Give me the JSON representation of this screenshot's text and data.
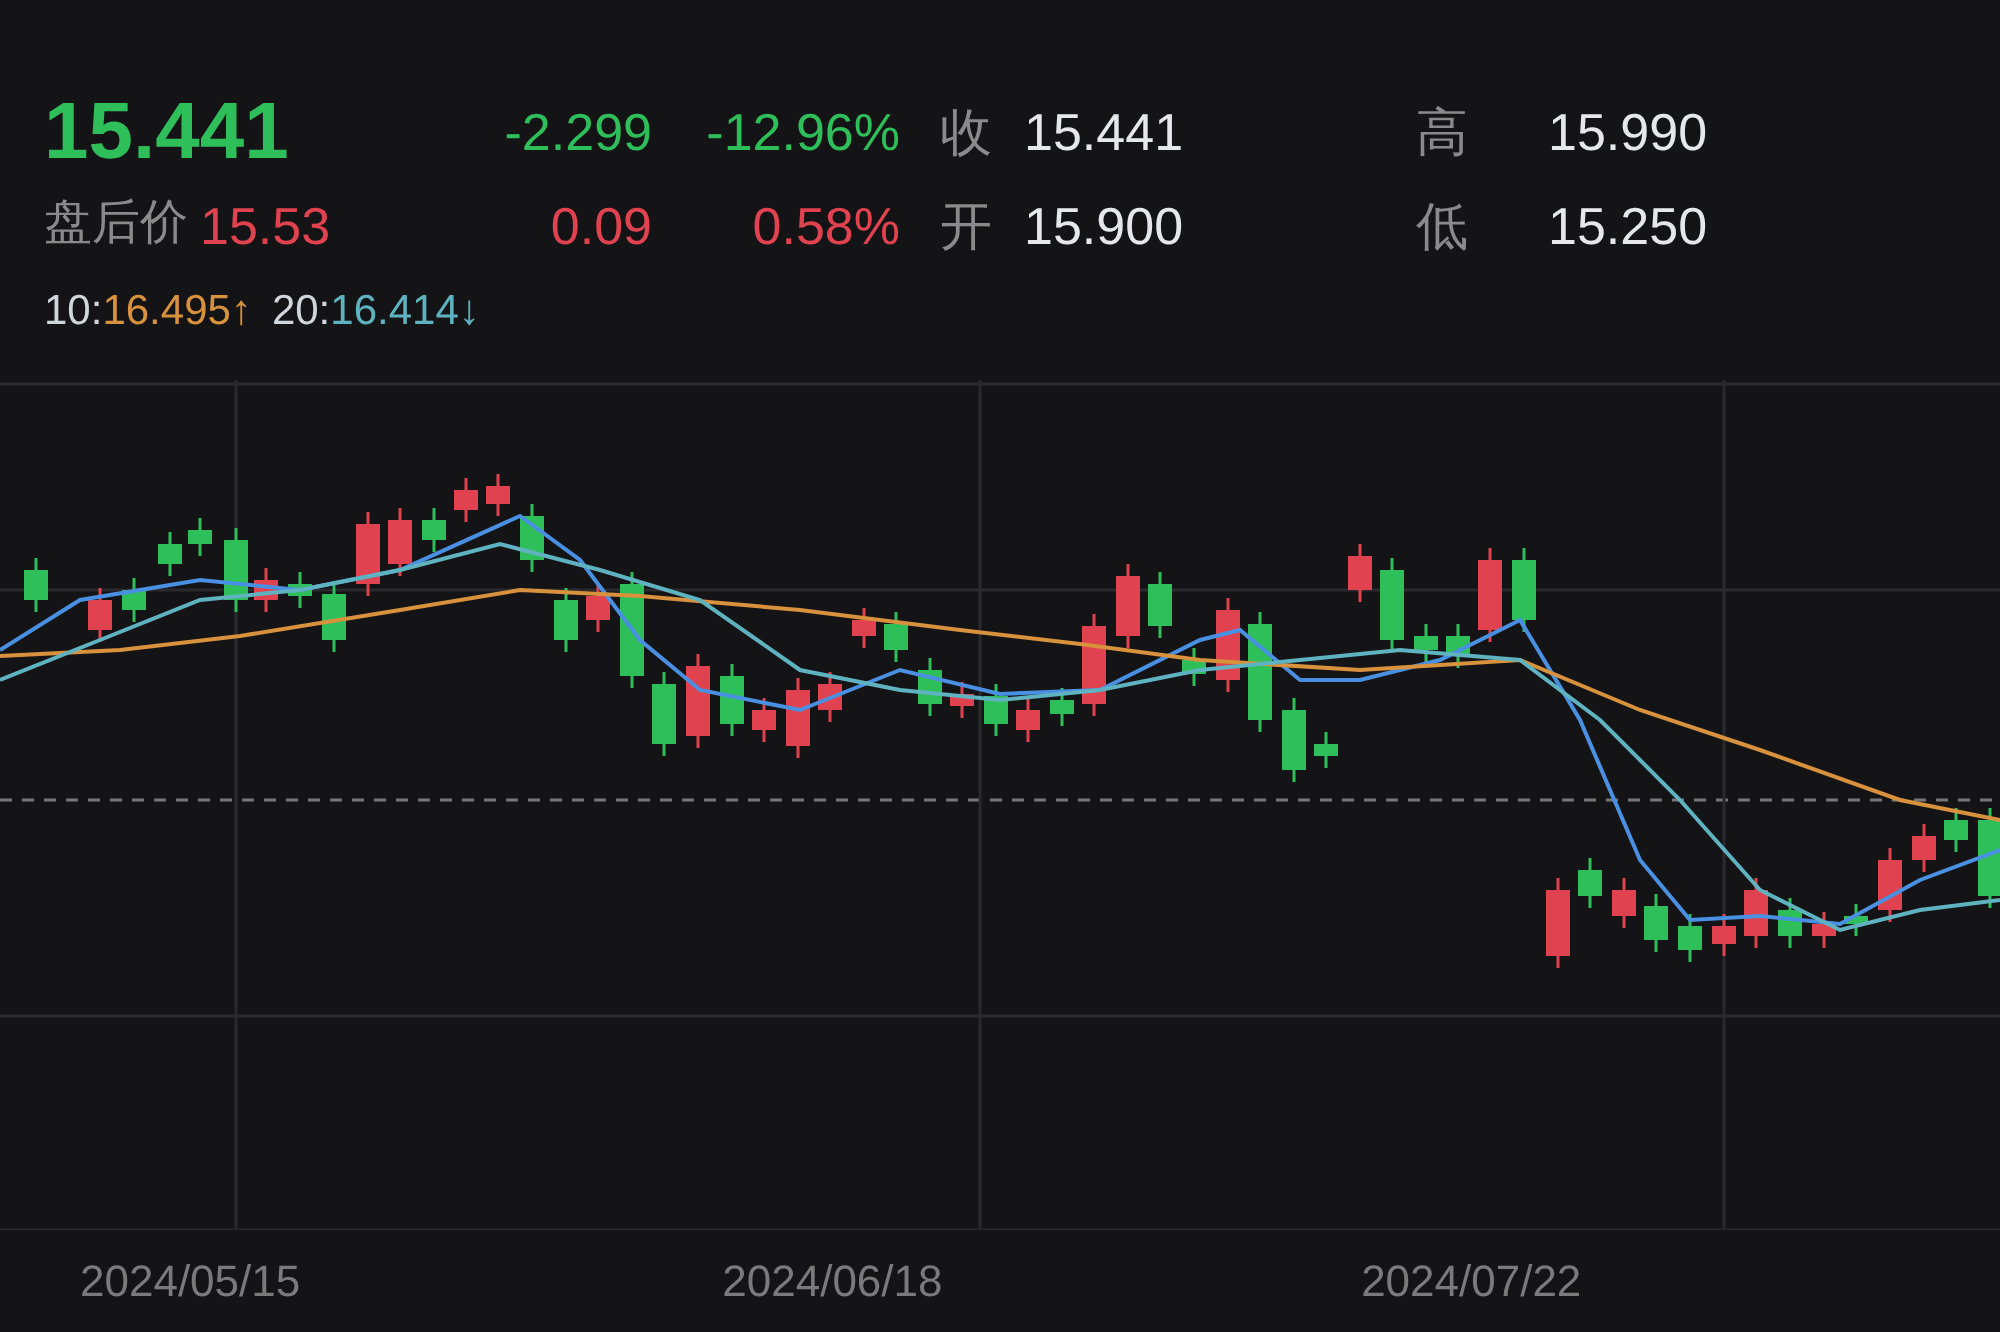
{
  "quote": {
    "falling": true,
    "price": "15.441",
    "change": "-2.299",
    "change_pct": "-12.96%",
    "close_label": "收",
    "close": "15.441",
    "high_label": "高",
    "high": "15.990",
    "open_label": "开",
    "open": "15.900",
    "low_label": "低",
    "low": "15.250"
  },
  "after_hours": {
    "falling": false,
    "label": "盘后价",
    "price": "15.53",
    "change": "0.09",
    "change_pct": "0.58%"
  },
  "moving_averages": [
    {
      "period": "10:",
      "value": "16.495",
      "arrow": "↑",
      "color": "#d8913c"
    },
    {
      "period": "20:",
      "value": "16.414",
      "arrow": "↓",
      "color": "#5fb3c0"
    }
  ],
  "x_labels": [
    "2024/05/15",
    "2024/06/18",
    "2024/07/22"
  ]
}
